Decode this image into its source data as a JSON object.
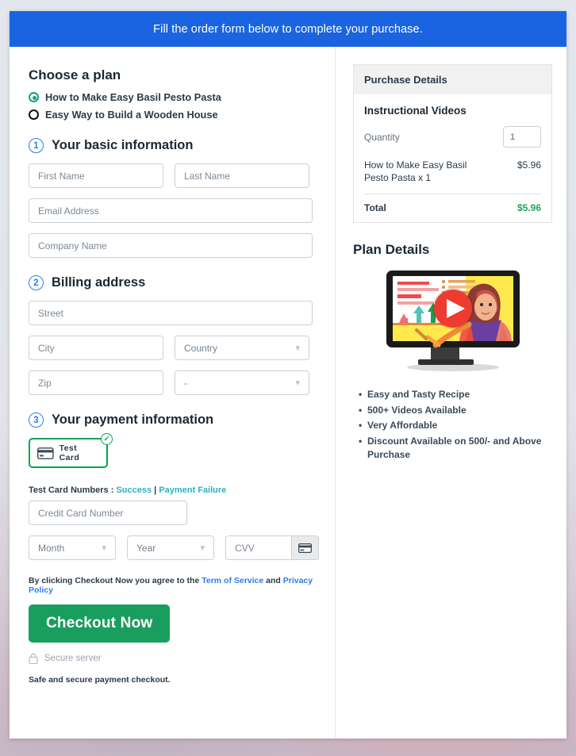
{
  "banner": {
    "text": "Fill the order form below to complete your purchase."
  },
  "plans": {
    "heading": "Choose a plan",
    "options": [
      {
        "label": "How to Make Easy Basil Pesto Pasta",
        "selected": true
      },
      {
        "label": "Easy Way to Build a Wooden House",
        "selected": false
      }
    ]
  },
  "steps": [
    {
      "num": "1",
      "title": "Your basic information"
    },
    {
      "num": "2",
      "title": "Billing address"
    },
    {
      "num": "3",
      "title": "Your payment information"
    }
  ],
  "basic": {
    "first_name_placeholder": "First Name",
    "last_name_placeholder": "Last Name",
    "email_placeholder": "Email Address",
    "company_placeholder": "Company Name"
  },
  "billing": {
    "street_placeholder": "Street",
    "city_placeholder": "City",
    "country_value": "Country",
    "zip_placeholder": "Zip",
    "state_value": "-"
  },
  "payment": {
    "method_label": "Test Card",
    "method_selected": true,
    "card_icon": "credit-card-icon",
    "check_icon": "✓",
    "test_numbers_label": "Test Card Numbers : ",
    "success_link": "Success",
    "separator": " | ",
    "failure_link": "Payment Failure",
    "card_number_placeholder": "Credit Card Number",
    "month_value": "Month",
    "year_value": "Year",
    "cvv_placeholder": "CVV",
    "cvv_icon": "credit-card-icon"
  },
  "footer": {
    "terms_prefix": "By clicking Checkout Now you agree to the ",
    "terms_link": "Term of Service",
    "terms_and": " and ",
    "privacy_link": "Privacy Policy",
    "checkout_label": "Checkout Now",
    "secure_label": "Secure server",
    "lock_icon": "lock-icon",
    "safe_note": "Safe and secure payment checkout."
  },
  "purchase": {
    "header": "Purchase Details",
    "product_title": "Instructional Videos",
    "quantity_label": "Quantity",
    "quantity_value": "1",
    "item_name": "How to Make Easy Basil Pesto Pasta x 1",
    "item_price": "$5.96",
    "total_label": "Total",
    "total_value": "$5.96"
  },
  "plan_details": {
    "heading": "Plan Details",
    "illustration": "video-lesson-illustration",
    "features": [
      "Easy and Tasty Recipe",
      "500+ Videos Available",
      "Very Affordable",
      "Discount Available on 500/- and Above Purchase"
    ]
  },
  "colors": {
    "banner_blue": "#1a64e2",
    "accent_blue": "#2b7cf0",
    "green": "#00a550",
    "checkout_green": "#1a9e5e",
    "total_green": "#18a85b",
    "link_teal": "#2bb3c0"
  }
}
